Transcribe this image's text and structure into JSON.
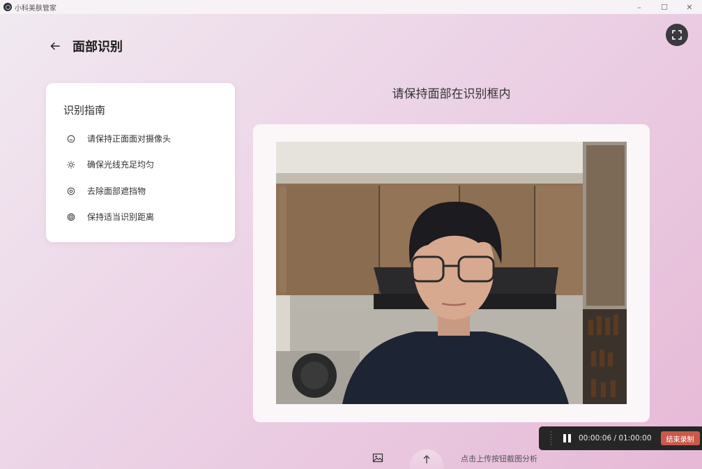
{
  "window": {
    "title": "小科美肤管家",
    "minimize": "–",
    "maximize": "☐",
    "close": "✕"
  },
  "header": {
    "back_icon": "back-arrow-icon",
    "title": "面部识别"
  },
  "guide": {
    "title": "识别指南",
    "items": [
      {
        "icon": "smile-icon",
        "text": "请保持正面面对摄像头"
      },
      {
        "icon": "sun-icon",
        "text": "确保光线充足均匀"
      },
      {
        "icon": "eye-icon",
        "text": "去除面部遮挡物"
      },
      {
        "icon": "target-icon",
        "text": "保持适当识别距离"
      }
    ]
  },
  "camera": {
    "prompt": "请保持面部在识别框内"
  },
  "recording": {
    "time": "00:00:06 / 01:00:00",
    "end_label": "结束录制"
  },
  "bottom": {
    "upload_hint": "点击上传按钮截图分析"
  },
  "colors": {
    "accent_end": "#c85a4b",
    "recorder_bg": "#262626",
    "card_bg": "#ffffff"
  }
}
